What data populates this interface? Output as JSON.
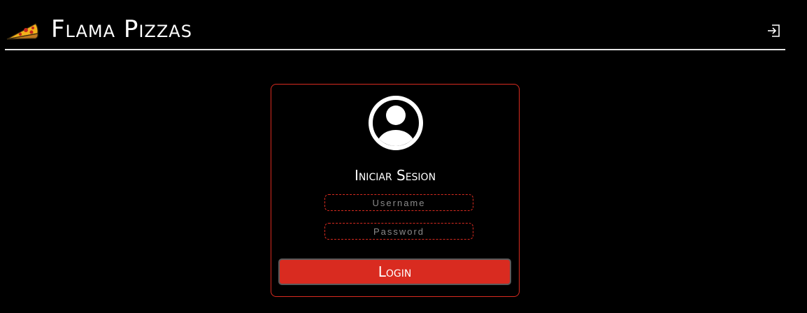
{
  "header": {
    "brand": "Flama Pizzas",
    "logo_icon": "pizza-slice-icon",
    "logout_icon": "logout-icon"
  },
  "login": {
    "avatar_icon": "user-circle-icon",
    "title": "Iniciar Sesion",
    "username_placeholder": "Username",
    "username_value": "",
    "password_placeholder": "Password",
    "password_value": "",
    "button_label": "Login"
  },
  "colors": {
    "background": "#000000",
    "accent": "#d92b20",
    "text": "#ffffff",
    "placeholder": "#8a8a8a",
    "divider": "#e6e6e6"
  }
}
